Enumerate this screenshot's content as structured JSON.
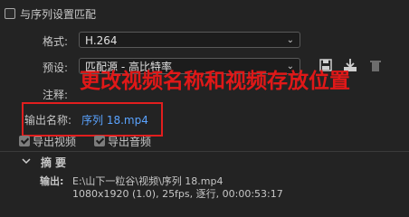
{
  "match_sequence": {
    "label": "与序列设置匹配",
    "checked": false
  },
  "format": {
    "label": "格式:",
    "value": "H.264"
  },
  "preset": {
    "label": "预设:",
    "value": "匹配源 - 高比特率"
  },
  "comments": {
    "label": "注释:"
  },
  "overlay_text": "更改视频名称和视频存放位置",
  "output_name": {
    "label": "输出名称:",
    "value": "序列 18.mp4"
  },
  "export_video": {
    "label": "导出视频",
    "checked": true
  },
  "export_audio": {
    "label": "导出音频",
    "checked": true
  },
  "summary": {
    "title": "摘要",
    "output_label": "输出:",
    "output_path": "E:\\山下一粒谷\\视频\\序列 18.mp4",
    "output_details": "1080x1920 (1.0), 25fps, 逐行, 00:00:53:17"
  },
  "colors": {
    "accent_link": "#5aa3ff",
    "annotation_red": "#e01818",
    "background": "#232323"
  },
  "icons": [
    "save-preset-icon",
    "import-preset-icon",
    "delete-preset-icon",
    "chevron-down-icon",
    "expand-toggle-icon"
  ]
}
